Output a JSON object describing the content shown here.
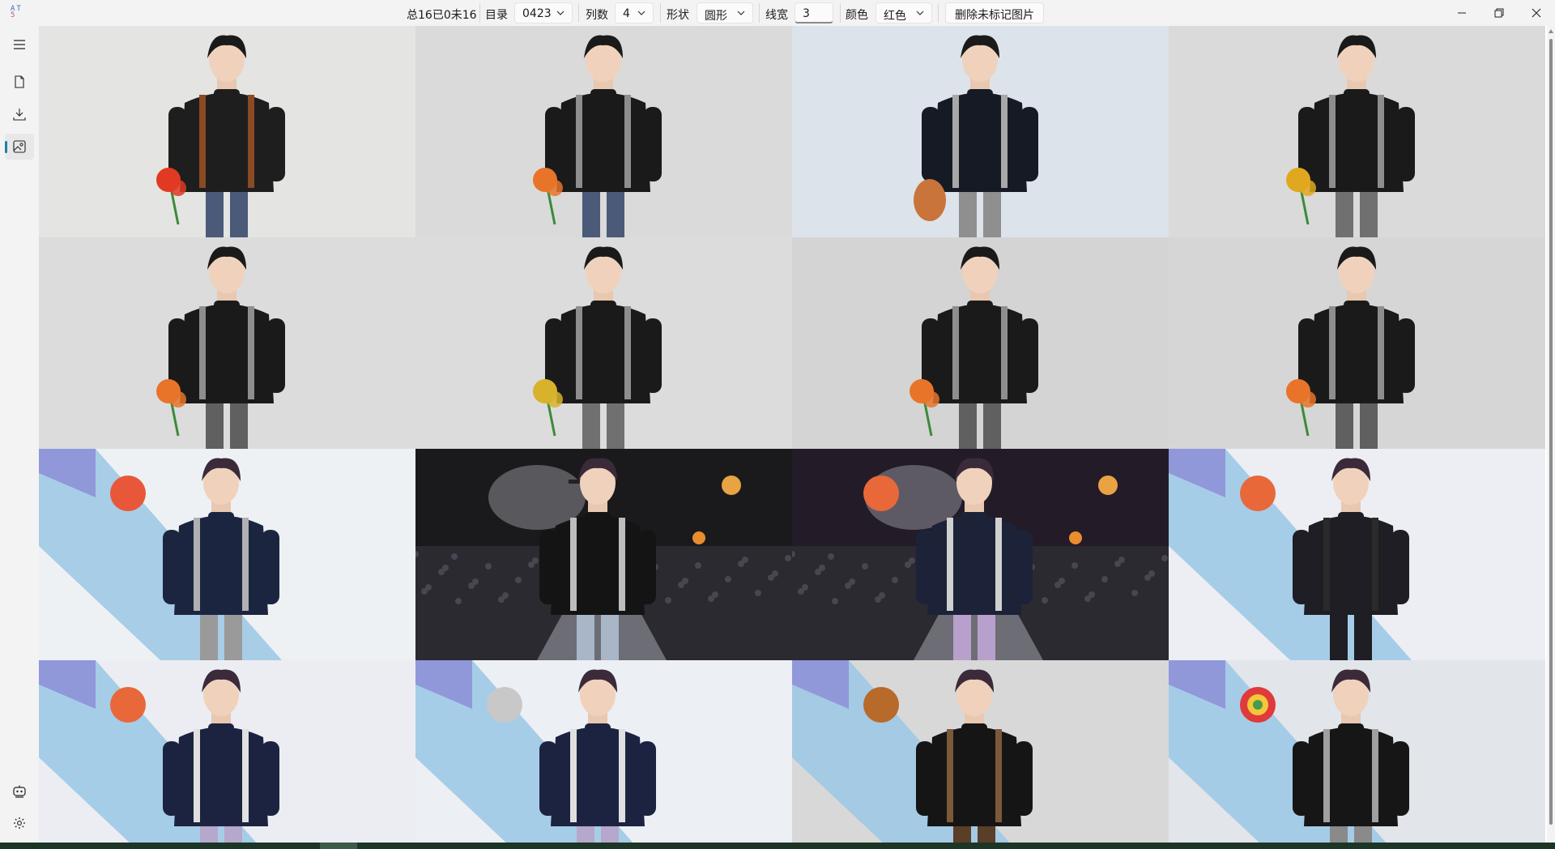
{
  "app": {
    "name": "AT5",
    "logo_line1": "AT",
    "logo_line2": "5"
  },
  "toolbar": {
    "summary": "总16已0未16",
    "dir_label": "目录",
    "dir_value": "0423",
    "cols_label": "列数",
    "cols_value": "4",
    "shape_label": "形状",
    "shape_value": "圆形",
    "linewidth_label": "线宽",
    "linewidth_value": "3",
    "color_label": "颜色",
    "color_value": "红色",
    "delete_button": "删除未标记图片"
  },
  "window_controls": {
    "minimize": "minimize-icon",
    "restore": "restore-icon",
    "close": "close-icon"
  },
  "sidebar": {
    "items": [
      {
        "icon": "menu-icon",
        "active": false
      },
      {
        "icon": "file-icon",
        "active": false
      },
      {
        "icon": "download-icon",
        "active": false
      },
      {
        "icon": "image-icon",
        "active": true
      }
    ],
    "bottom": [
      {
        "icon": "robot-icon"
      },
      {
        "icon": "settings-icon"
      }
    ]
  },
  "colors": {
    "accent": "#1f7fa8",
    "taskbar": "#1d3526"
  },
  "gallery": {
    "columns": 4,
    "tiles": [
      {
        "scene": "studio",
        "bg": "#e4e4e2",
        "clothes": "#1e1e1e",
        "straps": "#8a4a22",
        "pants": "#4a5a78",
        "prop": "flower",
        "prop_color": "#e03a22"
      },
      {
        "scene": "studio",
        "bg": "#dadada",
        "clothes": "#1a1a1a",
        "straps": "#8e8e8e",
        "pants": "#4a5a78",
        "prop": "flower",
        "prop_color": "#e8742a"
      },
      {
        "scene": "studio",
        "bg": "#dde3ea",
        "clothes": "#151a24",
        "straps": "#a8a8a8",
        "pants": "#8f8f8f",
        "prop": "pinecone",
        "prop_color": "#c9743a"
      },
      {
        "scene": "studio",
        "bg": "#dadada",
        "clothes": "#1a1a1a",
        "straps": "#8e8e8e",
        "pants": "#707070",
        "prop": "flower",
        "prop_color": "#e0a81e"
      },
      {
        "scene": "studio",
        "bg": "#dcdcdc",
        "clothes": "#1a1a1a",
        "straps": "#8e8e8e",
        "pants": "#606060",
        "prop": "flower",
        "prop_color": "#e8742a"
      },
      {
        "scene": "studio",
        "bg": "#dcdcdc",
        "clothes": "#1a1a1a",
        "straps": "#8e8e8e",
        "pants": "#707070",
        "prop": "flower",
        "prop_color": "#d8b22a"
      },
      {
        "scene": "studio",
        "bg": "#d4d4d4",
        "clothes": "#1a1a1a",
        "straps": "#8e8e8e",
        "pants": "#606060",
        "prop": "flower",
        "prop_color": "#e8742a"
      },
      {
        "scene": "studio",
        "bg": "#d6d6d6",
        "clothes": "#1a1a1a",
        "straps": "#8e8e8e",
        "pants": "#606060",
        "prop": "flower",
        "prop_color": "#e8742a"
      },
      {
        "scene": "stripes",
        "bg": "#eef1f4",
        "clothes": "#1c2540",
        "straps": "#b0b0b0",
        "pants": "#9a9a9a",
        "prop": "ball",
        "prop_color": "#e8573a"
      },
      {
        "scene": "concert",
        "bg": "#1a1a1c",
        "clothes": "#141414",
        "straps": "#bdbdbd",
        "pants": "#a8b6c8",
        "prop": "mic",
        "prop_color": "#222222"
      },
      {
        "scene": "concert",
        "bg": "#231c28",
        "clothes": "#1c2238",
        "straps": "#d0d0d0",
        "pants": "#b8a0cc",
        "prop": "ball",
        "prop_color": "#e8683a"
      },
      {
        "scene": "stripes",
        "bg": "#eceef4",
        "clothes": "#1e1e24",
        "straps": "#2a2a2a",
        "pants": "#1e1e24",
        "prop": "ball",
        "prop_color": "#e8683a"
      },
      {
        "scene": "stripes",
        "bg": "#ecedf3",
        "clothes": "#1c2340",
        "straps": "#e0e0e0",
        "pants": "#b6a8cc",
        "prop": "ball",
        "prop_color": "#e8683a"
      },
      {
        "scene": "stripes",
        "bg": "#eceff4",
        "clothes": "#1c2340",
        "straps": "#e0e0e0",
        "pants": "#b6a8cc",
        "prop": "ball",
        "prop_color": "#c8c8c8"
      },
      {
        "scene": "stripes",
        "bg": "#d8d8d8",
        "clothes": "#151515",
        "straps": "#7a5a3a",
        "pants": "#5a3e28",
        "prop": "ball",
        "prop_color": "#b86a2a"
      },
      {
        "scene": "stripes",
        "bg": "#e2e5ea",
        "clothes": "#161616",
        "straps": "#a0a0a0",
        "pants": "#8a8a8a",
        "prop": "lollipop",
        "prop_color": "#e03a3a"
      }
    ]
  }
}
